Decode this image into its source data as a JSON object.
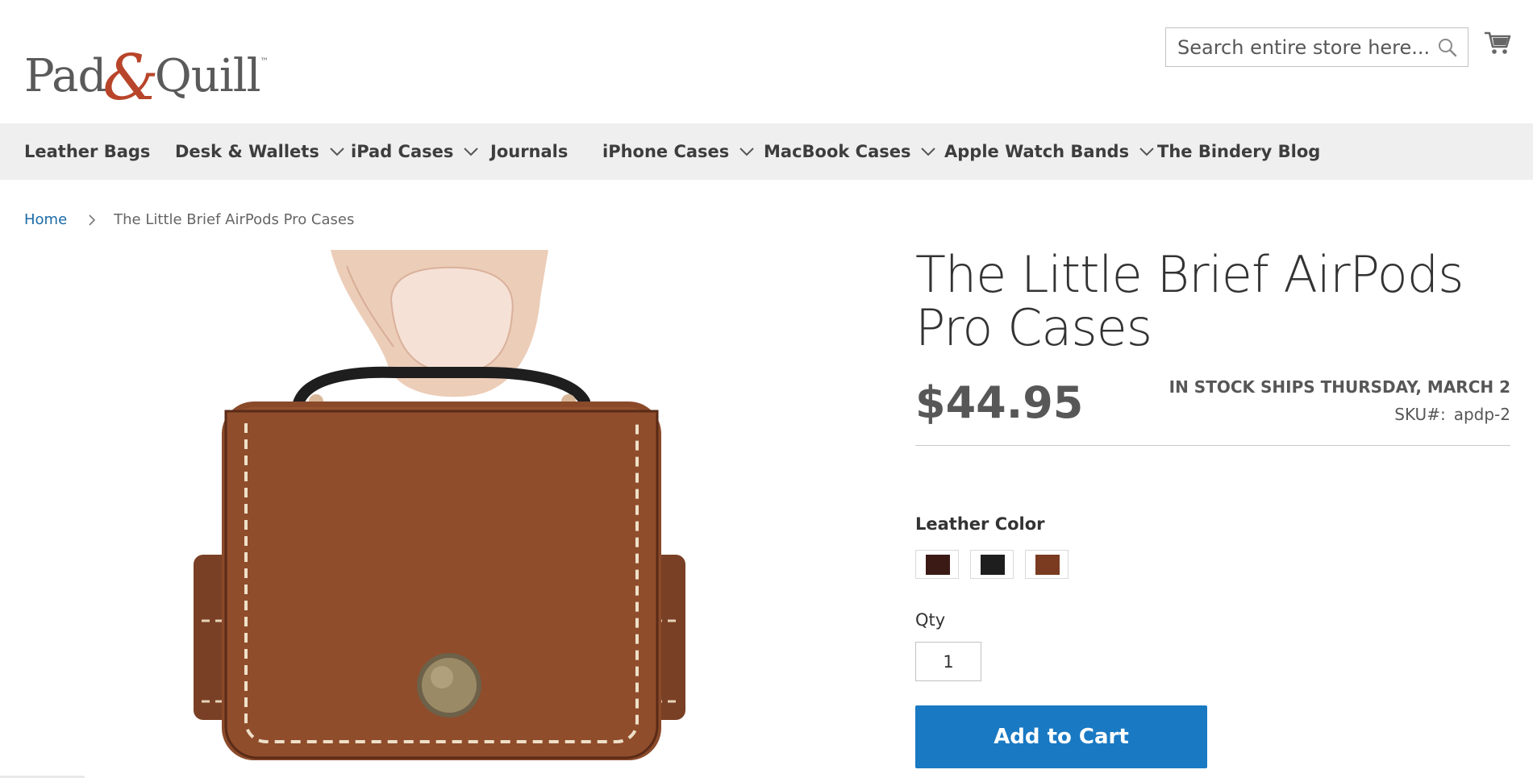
{
  "header": {
    "logo": {
      "left_word": "Pad",
      "ampersand": "&",
      "right_word": "Quill",
      "tm": "™"
    },
    "search": {
      "placeholder": "Search entire store here...",
      "value": ""
    },
    "icons": {
      "search": "search-icon",
      "cart": "cart-icon"
    }
  },
  "nav": {
    "items": [
      {
        "label": "Leather Bags",
        "has_dropdown": false
      },
      {
        "label": "Desk & Wallets",
        "has_dropdown": true
      },
      {
        "label": "iPad Cases",
        "has_dropdown": true
      },
      {
        "label": "Journals",
        "has_dropdown": false
      },
      {
        "label": "iPhone Cases",
        "has_dropdown": true
      },
      {
        "label": "MacBook Cases",
        "has_dropdown": true
      },
      {
        "label": "Apple Watch Bands",
        "has_dropdown": true
      },
      {
        "label": "The Bindery Blog",
        "has_dropdown": false
      }
    ]
  },
  "breadcrumb": {
    "home": "Home",
    "current": "The Little Brief AirPods Pro Cases"
  },
  "product": {
    "title": "The Little Brief AirPods Pro Cases",
    "price": "$44.95",
    "stock_status": "IN STOCK SHIPS THURSDAY, MARCH 2",
    "sku_label": "SKU#:",
    "sku_value": "apdp-2",
    "color_label": "Leather Color",
    "colors": [
      {
        "name": "Chocolate",
        "hex": "#3b1a16"
      },
      {
        "name": "Black",
        "hex": "#1e1e1e"
      },
      {
        "name": "Saddle",
        "hex": "#7a3b21"
      }
    ],
    "qty_label": "Qty",
    "qty_value": "1",
    "add_to_cart": "Add to Cart"
  },
  "colors": {
    "accent": "#1979c3",
    "link": "#1a6aa8",
    "nav_bg": "#efefef",
    "leather": "#8a4a2a",
    "logo_red": "#b8452a"
  }
}
